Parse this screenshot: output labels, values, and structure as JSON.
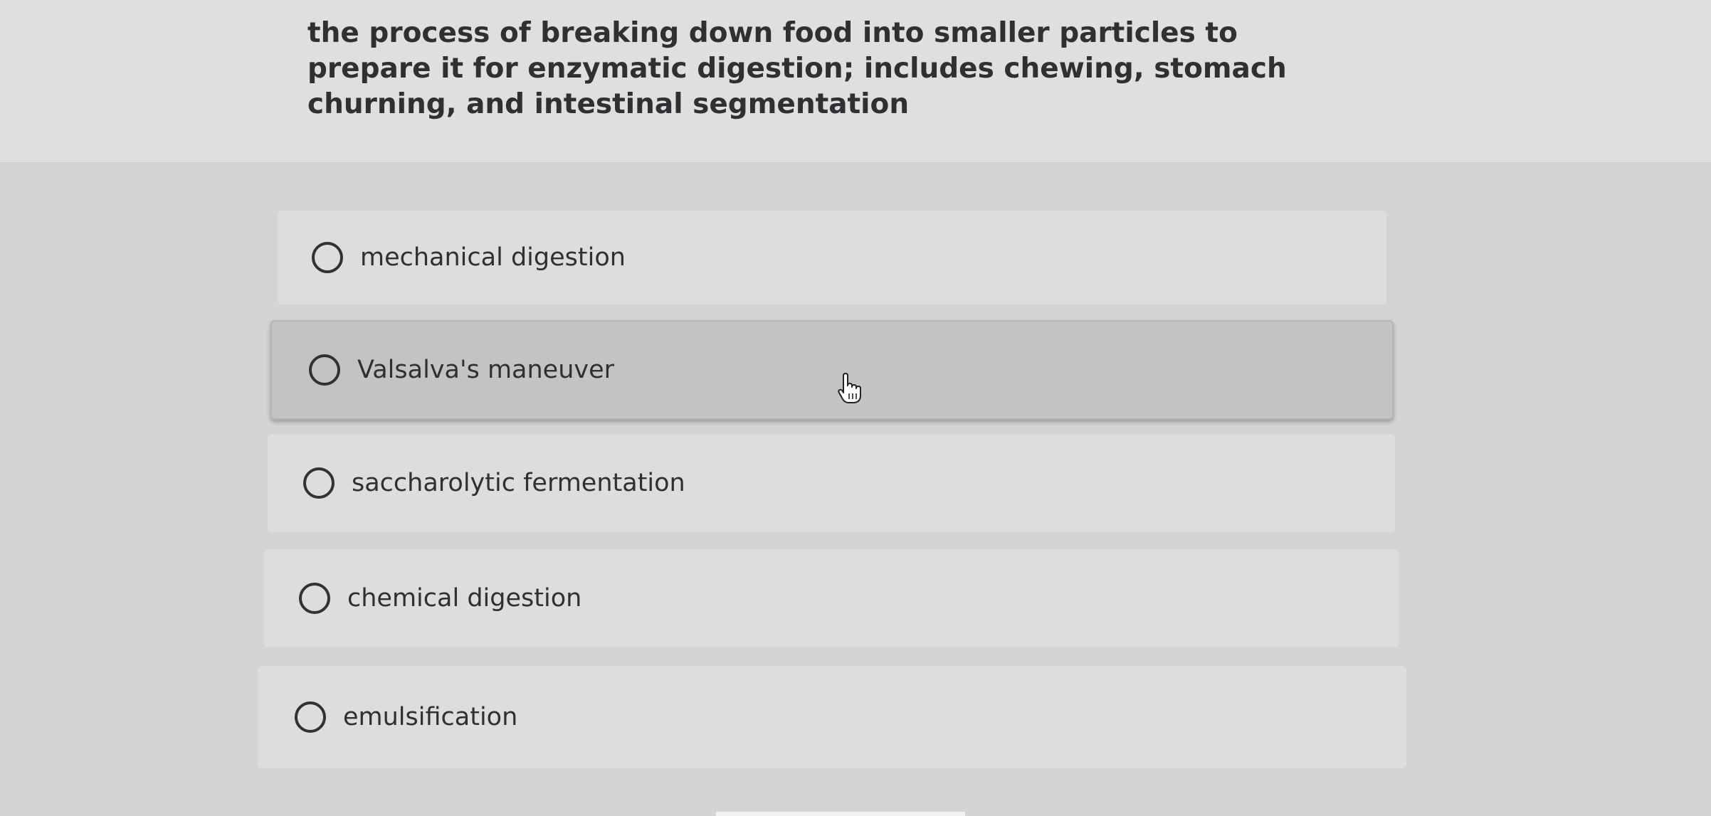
{
  "question": {
    "text": "the process of breaking down food into smaller particles to prepare it for enzymatic digestion; includes chewing, stomach churning, and intestinal segmentation"
  },
  "options": [
    {
      "label": "mechanical digestion",
      "selected": false
    },
    {
      "label": "Valsalva's maneuver",
      "selected": false,
      "hovered": true
    },
    {
      "label": "saccharolytic fermentation",
      "selected": false
    },
    {
      "label": "chemical digestion",
      "selected": false
    },
    {
      "label": "emulsification",
      "selected": false
    }
  ],
  "cursor": {
    "icon": "hand-pointer-icon"
  }
}
